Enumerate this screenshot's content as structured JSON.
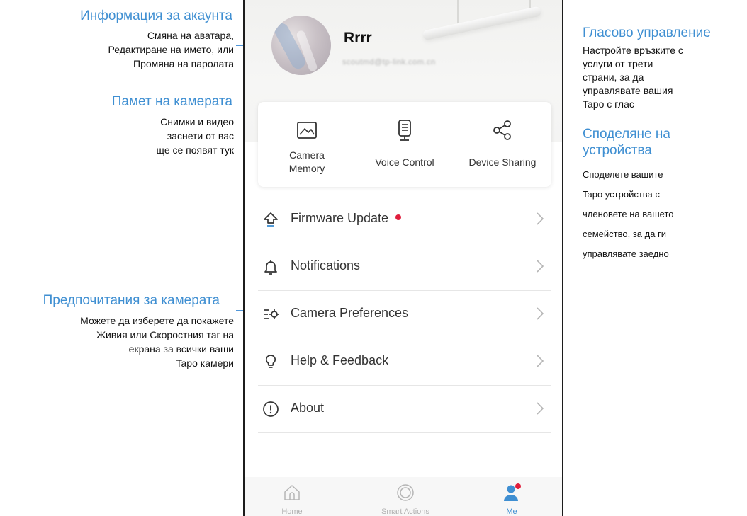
{
  "annotations": {
    "account_info": {
      "title": "Информация за акаунта",
      "lines": [
        "Смяна на аватара,",
        "Редактиране на името, или",
        "Промяна на паролата"
      ]
    },
    "camera_memory": {
      "title": "Памет на камерата",
      "lines": [
        "Снимки и видео",
        "заснети от вас",
        "ще се появят тук"
      ]
    },
    "camera_preferences": {
      "title": "Предпочитания за камерата",
      "lines": [
        "Можете да изберете да покажете",
        "Живия или Скоростния таг на",
        "екрана за всички ваши",
        "Tapo камери"
      ]
    },
    "voice_control": {
      "title": "Гласово управление",
      "lines": [
        "Настройте връзките с",
        "услуги от трети",
        "страни, за да",
        "управлявате вашия",
        "Tapo с глас"
      ]
    },
    "device_sharing": {
      "title_lines": [
        "Споделяне на",
        "устройства"
      ],
      "lines": [
        "Споделете вашите",
        "Tapo устройства с",
        "членовете на вашето",
        "семейство, за да ги",
        "управлявате заедно"
      ]
    }
  },
  "profile": {
    "username": "Rrrr",
    "email": "scoutmd@tp-link.com.cn"
  },
  "features": {
    "camera_memory": {
      "line1": "Camera",
      "line2": "Memory",
      "icon": "photo-frame-icon"
    },
    "voice_control": {
      "label": "Voice Control",
      "icon": "smart-speaker-icon"
    },
    "device_sharing": {
      "label": "Device Sharing",
      "icon": "share-icon"
    }
  },
  "menu": [
    {
      "label": "Firmware Update",
      "icon": "upload-arrow-icon",
      "badge": true
    },
    {
      "label": "Notifications",
      "icon": "bell-icon",
      "badge": false
    },
    {
      "label": "Camera Preferences",
      "icon": "settings-sliders-icon",
      "badge": false
    },
    {
      "label": "Help & Feedback",
      "icon": "lightbulb-icon",
      "badge": false
    },
    {
      "label": "About",
      "icon": "exclamation-circle-icon",
      "badge": false
    }
  ],
  "tabbar": {
    "home": "Home",
    "smart_actions": "Smart Actions",
    "me": "Me",
    "active": "me"
  },
  "colors": {
    "accent": "#3f8fd2",
    "badge": "#e01e3c",
    "annotation_line": "#4f95d8"
  }
}
